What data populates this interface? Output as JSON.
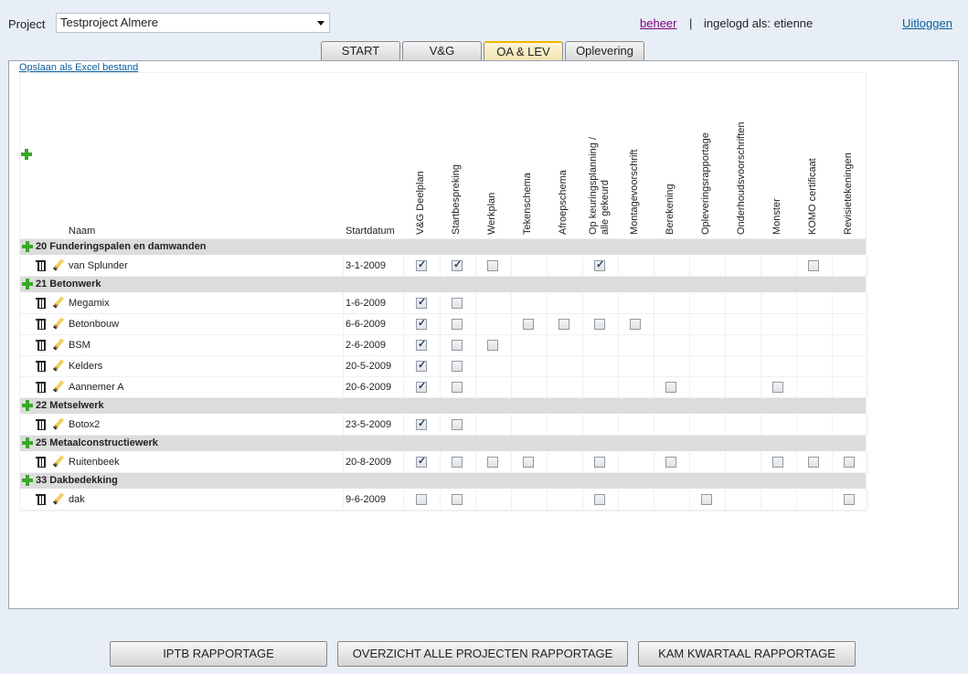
{
  "header": {
    "project_label": "Project",
    "project_value": "Testproject Almere",
    "admin_link": "beheer",
    "separator": "|",
    "logged_in": "ingelogd als: etienne",
    "logout": "Uitloggen"
  },
  "tabs": [
    "START",
    "V&G",
    "OA & LEV",
    "Oplevering"
  ],
  "active_tab": "OA & LEV",
  "export_link": "Opslaan als Excel bestand",
  "table": {
    "name_header": "Naam",
    "date_header": "Startdatum",
    "columns": [
      "V&G Deelplan",
      "Startbespreking",
      "Werkplan",
      "Tekenschema",
      "Afroepschema",
      "Op keuringsplanning / alle gekeurd",
      "Montagevoorschrift",
      "Berekening",
      "Opleveringsrapportage",
      "Onderhoudsvoorschriften",
      "Monster",
      "KOMO certificaat",
      "Revisietekeningen"
    ],
    "groups": [
      {
        "title": "20 Funderingspalen en damwanden",
        "rows": [
          {
            "name": "van Splunder",
            "date": "3-1-2009",
            "cells": [
              1,
              1,
              0,
              null,
              null,
              1,
              null,
              null,
              null,
              null,
              null,
              0,
              null
            ]
          }
        ]
      },
      {
        "title": "21 Betonwerk",
        "rows": [
          {
            "name": "Megamix",
            "date": "1-6-2009",
            "cells": [
              1,
              0,
              null,
              null,
              null,
              null,
              null,
              null,
              null,
              null,
              null,
              null,
              null
            ]
          },
          {
            "name": "Betonbouw",
            "date": "6-6-2009",
            "cells": [
              1,
              0,
              null,
              0,
              0,
              0,
              0,
              null,
              null,
              null,
              null,
              null,
              null
            ]
          },
          {
            "name": "BSM",
            "date": "2-6-2009",
            "cells": [
              1,
              0,
              0,
              null,
              null,
              null,
              null,
              null,
              null,
              null,
              null,
              null,
              null
            ]
          },
          {
            "name": "Kelders",
            "date": "20-5-2009",
            "cells": [
              1,
              0,
              null,
              null,
              null,
              null,
              null,
              null,
              null,
              null,
              null,
              null,
              null
            ]
          },
          {
            "name": "Aannemer A",
            "date": "20-6-2009",
            "cells": [
              1,
              0,
              null,
              null,
              null,
              null,
              null,
              0,
              null,
              null,
              0,
              null,
              null
            ]
          }
        ]
      },
      {
        "title": "22 Metselwerk",
        "rows": [
          {
            "name": "Botox2",
            "date": "23-5-2009",
            "cells": [
              1,
              0,
              null,
              null,
              null,
              null,
              null,
              null,
              null,
              null,
              null,
              null,
              null
            ]
          }
        ]
      },
      {
        "title": "25 Metaalconstructiewerk",
        "rows": [
          {
            "name": "Ruitenbeek",
            "date": "20-8-2009",
            "cells": [
              1,
              0,
              0,
              0,
              null,
              0,
              null,
              0,
              null,
              null,
              0,
              0,
              0
            ]
          }
        ]
      },
      {
        "title": "33 Dakbedekking",
        "rows": [
          {
            "name": "dak",
            "date": "9-6-2009",
            "cells": [
              0,
              0,
              null,
              null,
              null,
              0,
              null,
              null,
              0,
              null,
              null,
              null,
              0
            ]
          }
        ]
      }
    ]
  },
  "buttons": [
    "IPTB RAPPORTAGE",
    "OVERZICHT ALLE PROJECTEN RAPPORTAGE",
    "KAM KWARTAAL RAPPORTAGE"
  ]
}
